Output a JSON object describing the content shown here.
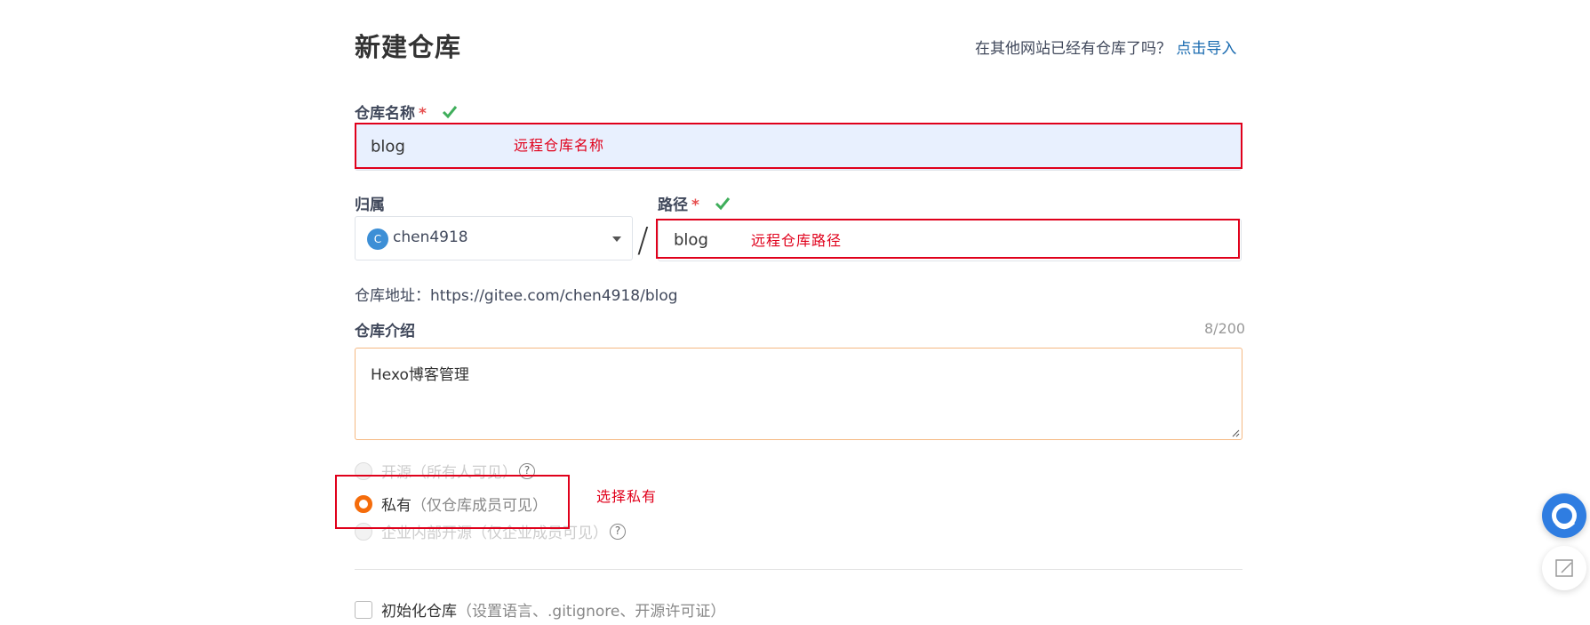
{
  "page": {
    "title": "新建仓库"
  },
  "import": {
    "hint": "在其他网站已经有仓库了吗？",
    "link": "点击导入"
  },
  "repo_name": {
    "label": "仓库名称",
    "required": "*",
    "value": "blog",
    "annotation": "远程仓库名称"
  },
  "owner": {
    "label": "归属",
    "avatar_letter": "C",
    "value": "chen4918"
  },
  "path": {
    "label": "路径",
    "required": "*",
    "value": "blog",
    "annotation": "远程仓库路径",
    "separator": "/"
  },
  "address": {
    "text": "仓库地址：https://gitee.com/chen4918/blog"
  },
  "description": {
    "label": "仓库介绍",
    "counter": "8/200",
    "value": "Hexo博客管理"
  },
  "visibility": {
    "options": [
      {
        "label": "开源（所有人可见）",
        "selected": false,
        "disabled": true
      },
      {
        "label": "私有",
        "sub": "（仅仓库成员可见）",
        "selected": true
      },
      {
        "label": "企业内部开源（仅企业成员可见）",
        "selected": false,
        "disabled": true
      }
    ],
    "annotation": "选择私有",
    "help": "?"
  },
  "init": {
    "label": "初始化仓库",
    "sub": "（设置语言、.gitignore、开源许可证）"
  },
  "colors": {
    "accent": "#f56c0b",
    "link": "#1a6bb0",
    "annotation": "#e0001b",
    "check": "#3fae5b"
  },
  "icons": [
    "check-icon",
    "chevron-down-icon",
    "help-icon",
    "chat-icon",
    "edit-icon"
  ]
}
